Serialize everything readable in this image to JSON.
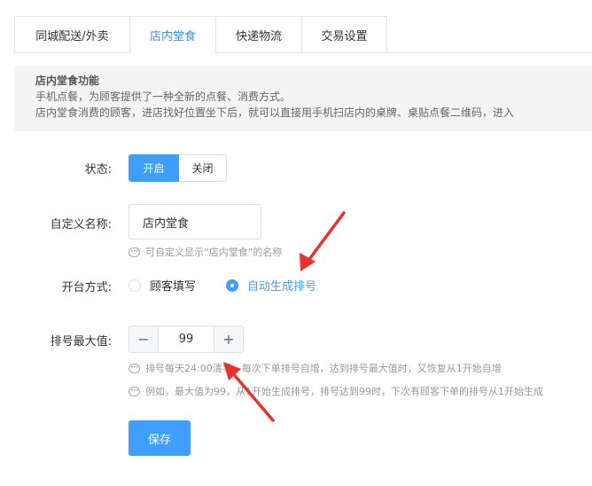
{
  "tabs": [
    {
      "label": "同城配送/外卖",
      "active": false
    },
    {
      "label": "店内堂食",
      "active": true
    },
    {
      "label": "快递物流",
      "active": false
    },
    {
      "label": "交易设置",
      "active": false
    }
  ],
  "info": {
    "title": "店内堂食功能",
    "line1": "手机点餐，为顾客提供了一种全新的点餐、消费方式。",
    "line2": "店内堂食消费的顾客，进店找好位置坐下后，就可以直接用手机扫店内的桌牌、桌贴点餐二维码，进入"
  },
  "form": {
    "status": {
      "label": "状态:",
      "on_label": "开启",
      "off_label": "关闭",
      "value": "开启"
    },
    "custom_name": {
      "label": "自定义名称:",
      "value": "店内堂食",
      "hint": "可自定义显示“店内堂食”的名称"
    },
    "open_mode": {
      "label": "开台方式:",
      "options": [
        "顾客填写",
        "自动生成排号"
      ],
      "selected": "自动生成排号"
    },
    "max_queue": {
      "label": "排号最大值:",
      "value": "99",
      "minus": "−",
      "plus": "+",
      "hint1": "排号每天24:00清零，每次下单排号自增，达到排号最大值时，又恢复从1开始自增",
      "hint2": "例如，最大值为99，从1开始生成排号，排号达到99时，下次有顾客下单的排号从1开始生成"
    },
    "save_label": "保存"
  },
  "colors": {
    "accent": "#409eff",
    "annotation_arrow": "#e8322d"
  },
  "icons": {
    "hint": "message-dots-icon"
  }
}
